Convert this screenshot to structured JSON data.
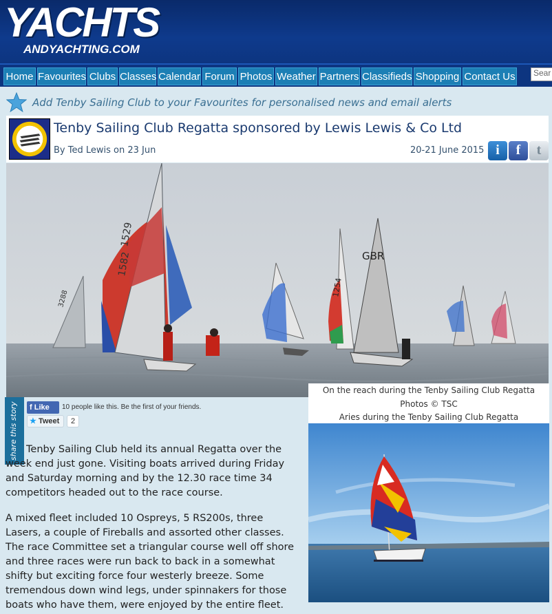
{
  "site": {
    "logo_main": "YACHTS",
    "logo_sub": "ANDYACHTING.COM"
  },
  "nav": {
    "items": [
      "Home",
      "Favourites",
      "Clubs",
      "Classes",
      "Calendar",
      "Forum",
      "Photos",
      "Weather",
      "Partners",
      "Classifieds",
      "Shopping",
      "Contact Us"
    ],
    "search_placeholder": "Sear"
  },
  "favourites": {
    "text": "Add Tenby Sailing Club to your Favourites for personalised news and email alerts"
  },
  "article": {
    "title": "Tenby Sailing Club Regatta sponsored by Lewis Lewis & Co Ltd",
    "byline": "By Ted Lewis on 23 Jun",
    "event_date": "20-21 June 2015",
    "paragraphs": [
      "Tenby Sailing Club held its annual Regatta over the week end just gone. Visiting boats arrived during Friday and Saturday morning and by the 12.30 race time 34 competitors headed out to the race course.",
      "A mixed fleet included 10 Ospreys, 5 RS200s, three Lasers, a couple of Fireballs and assorted other classes. The race Committee set a triangular course well off shore and three races were run back to back in a somewhat shifty but exciting force four westerly breeze. Some tremendous down wind legs, under spinnakers for those boats who have them, were enjoyed by the entire fleet."
    ]
  },
  "share_icons": {
    "info": "i",
    "facebook": "f",
    "twitter": "t"
  },
  "captions": {
    "main_photo": "On the reach during the Tenby Sailing Club Regatta",
    "credit": "Photos © TSC",
    "second_photo": "Aries during the Tenby Sailing Club Regatta"
  },
  "social": {
    "share_tab": "share this story",
    "like_label": "Like",
    "like_text": "10 people like this. Be the first of your friends.",
    "tweet_label": "Tweet",
    "tweet_count": "2"
  },
  "photo_text": {
    "sail_1": "1529",
    "sail_2": "1582",
    "sail_3": "GBR",
    "sail_4": "1254",
    "sail_5": "3288"
  },
  "colors": {
    "header": "#0d3580",
    "nav_item": "#1c7fb5",
    "title": "#1a3a6f",
    "background": "#d9e8f0"
  }
}
